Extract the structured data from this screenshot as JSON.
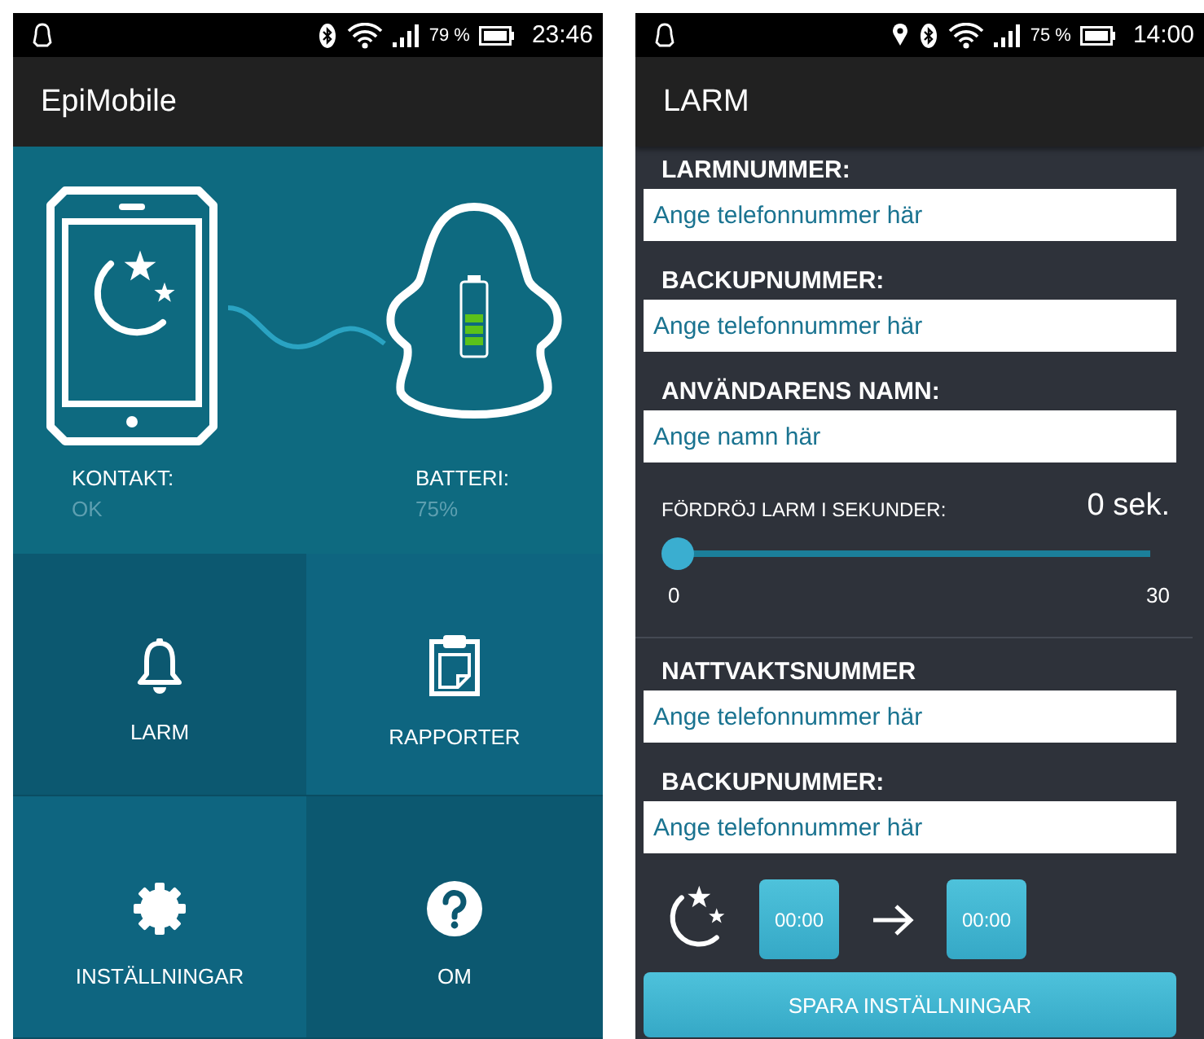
{
  "home_screen": {
    "status_bar": {
      "battery": "79 %",
      "time": "23:46"
    },
    "app_bar": {
      "title": "EpiMobile"
    },
    "status": [
      {
        "label": "KONTAKT:",
        "value": "OK"
      },
      {
        "label": "BATTERI:",
        "value": "75%"
      }
    ],
    "menu": [
      {
        "label": "LARM"
      },
      {
        "label": "RAPPORTER"
      },
      {
        "label": "INSTÄLLNINGAR"
      },
      {
        "label": "OM"
      }
    ]
  },
  "settings_screen": {
    "status_bar": {
      "battery": "75 %",
      "time": "14:00"
    },
    "app_bar": {
      "title": "LARM"
    },
    "alarm_fields": [
      {
        "label": "LARMNUMMER:",
        "placeholder": "Ange telefonnummer här"
      },
      {
        "label": "BACKUPNUMMER:",
        "placeholder": "Ange telefonnummer här"
      },
      {
        "label": "ANVÄNDARENS NAMN:",
        "placeholder": "Ange namn här"
      }
    ],
    "delay": {
      "label": "FÖRDRÖJ LARM I SEKUNDER:",
      "reading": "0 sek.",
      "level": 0,
      "min": "0",
      "max": "30"
    },
    "night_fields": [
      {
        "label": "NATTVAKTSNUMMER",
        "placeholder": "Ange telefonnummer här"
      },
      {
        "label": "BACKUPNUMMER:",
        "placeholder": "Ange telefonnummer här"
      }
    ],
    "schedule": {
      "start": "00:00",
      "end": "00:00"
    },
    "save_button": "SPARA INSTÄLLNINGAR"
  }
}
